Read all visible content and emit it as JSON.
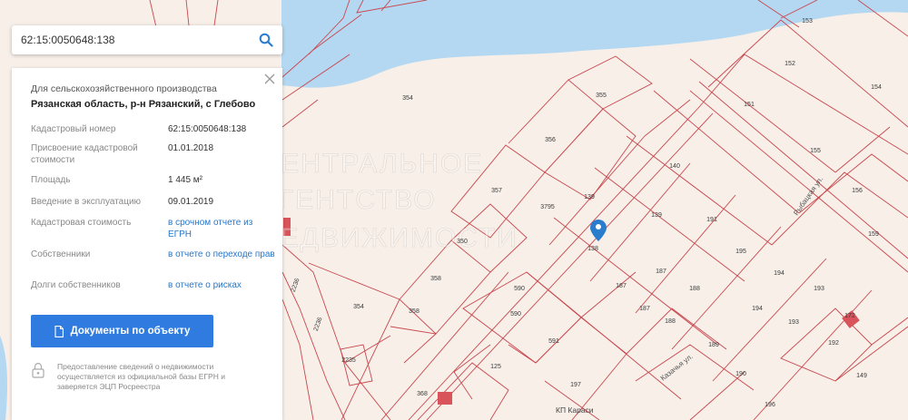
{
  "search": {
    "query": "62:15:0050648:138"
  },
  "card": {
    "category": "Для сельскохозяйственного производства",
    "address": "Рязанская область, р-н Рязанский, с Глебово",
    "rows": [
      {
        "label": "Кадастровый номер",
        "value": "62:15:0050648:138"
      },
      {
        "label": "Присвоение кадастровой стоимости",
        "value": "01.01.2018"
      },
      {
        "label": "Площадь",
        "value": "1 445 м²"
      },
      {
        "label": "Введение в эксплуатацию",
        "value": "09.01.2019"
      },
      {
        "label": "Кадастровая стоимость",
        "value": "в срочном отчете из ЕГРН"
      },
      {
        "label": "Собственники",
        "value": "в отчете о переходе прав"
      },
      {
        "label": "Долги собственников",
        "value": "в отчете о рисках"
      }
    ],
    "button_label": "Документы по объекту",
    "footnote": "Предоставление сведений о недвижимости осуществляется из официальной базы ЕГРН и заверяется ЭЦП Росреестра"
  },
  "map": {
    "water_color": "#b4d8f1",
    "parcel_line_color": "#c9474e",
    "marker_color": "#2a7ccc",
    "streets": [
      "Рыбацкая ул.",
      "Казачья ул.",
      "КП Караси"
    ],
    "watermark": "ЦЕНТРАЛЬНОЕ АГЕНТСТВО НЕДВИЖИМОСТИ",
    "parcels": [
      {
        "n": "153"
      },
      {
        "n": "152"
      },
      {
        "n": "154"
      },
      {
        "n": "151"
      },
      {
        "n": "155"
      },
      {
        "n": "156"
      },
      {
        "n": "354"
      },
      {
        "n": "355"
      },
      {
        "n": "356"
      },
      {
        "n": "357"
      },
      {
        "n": "3795"
      },
      {
        "n": "140"
      },
      {
        "n": "139"
      },
      {
        "n": "139"
      },
      {
        "n": "191"
      },
      {
        "n": "159"
      },
      {
        "n": "350"
      },
      {
        "n": "138"
      },
      {
        "n": "195"
      },
      {
        "n": "187"
      },
      {
        "n": "358"
      },
      {
        "n": "194"
      },
      {
        "n": "193"
      },
      {
        "n": "590"
      },
      {
        "n": "188"
      },
      {
        "n": "187"
      },
      {
        "n": "187"
      },
      {
        "n": "354"
      },
      {
        "n": "358"
      },
      {
        "n": "590"
      },
      {
        "n": "194"
      },
      {
        "n": "193"
      },
      {
        "n": "188"
      },
      {
        "n": "591"
      },
      {
        "n": "189"
      },
      {
        "n": "192"
      },
      {
        "n": "172"
      },
      {
        "n": "2235"
      },
      {
        "n": "125"
      },
      {
        "n": "190"
      },
      {
        "n": "149"
      },
      {
        "n": "197"
      },
      {
        "n": "368"
      },
      {
        "n": "196"
      },
      {
        "n": "2236"
      },
      {
        "n": "2236"
      }
    ]
  }
}
